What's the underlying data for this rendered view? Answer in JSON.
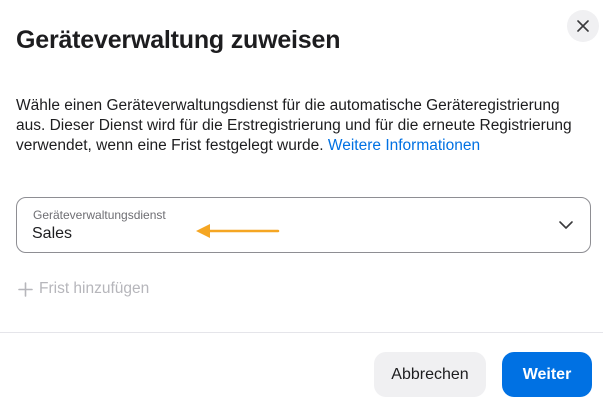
{
  "dialog": {
    "title": "Geräteverwaltung zuweisen",
    "description": "Wähle einen Geräteverwaltungsdienst für die automatische Geräteregistrierung aus. Dieser Dienst wird für die Erstregistrierung und für die erneute Registrierung verwendet, wenn eine Frist festgelegt wurde.",
    "learn_more_link": "Weitere Informationen",
    "close_icon": "close-icon"
  },
  "select": {
    "label": "Geräteverwaltungsdienst",
    "value": "Sales",
    "chevron_icon": "chevron-down-icon"
  },
  "add_deadline": {
    "label": "Frist hinzufügen",
    "icon": "plus-icon",
    "enabled": false
  },
  "footer": {
    "cancel_label": "Abbrechen",
    "confirm_label": "Weiter"
  },
  "colors": {
    "accent": "#0071e3",
    "annotation_arrow": "#f5a623",
    "disabled_text": "#b6b6bb"
  }
}
